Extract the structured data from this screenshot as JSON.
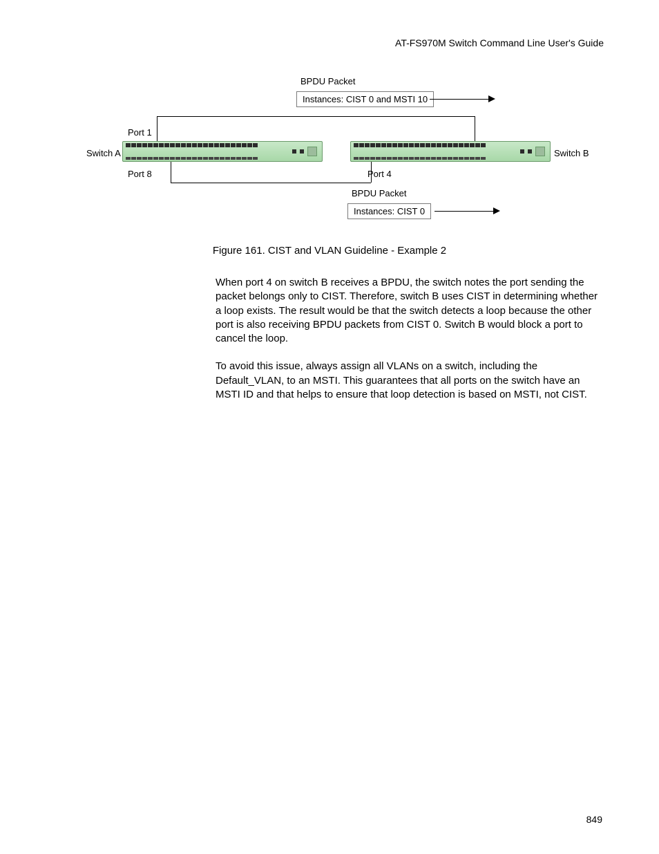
{
  "header": {
    "running_title": "AT-FS970M Switch Command Line User's Guide"
  },
  "diagram": {
    "bpdu_top_label": "BPDU Packet",
    "instances_top": "Instances: CIST 0 and MSTI 10",
    "switch_a_label": "Switch A",
    "switch_b_label": "Switch B",
    "port1_label": "Port 1",
    "port8_label": "Port 8",
    "port4_label": "Port 4",
    "bpdu_bottom_label": "BPDU Packet",
    "instances_bottom": "Instances: CIST 0"
  },
  "figure": {
    "caption": "Figure 161. CIST and VLAN Guideline - Example 2"
  },
  "body": {
    "p1": "When port 4 on switch B receives a BPDU, the switch notes the port sending the packet belongs only to CIST. Therefore, switch B uses CIST in determining whether a loop exists. The result would be that the switch detects a loop because the other port is also receiving BPDU packets from CIST 0. Switch B would block a port to cancel the loop.",
    "p2": "To avoid this issue, always assign all VLANs on a switch, including the Default_VLAN, to an MSTI. This guarantees that all ports on the switch have an MSTI ID and that helps to ensure that loop detection is based on MSTI, not CIST."
  },
  "page": {
    "number": "849"
  }
}
